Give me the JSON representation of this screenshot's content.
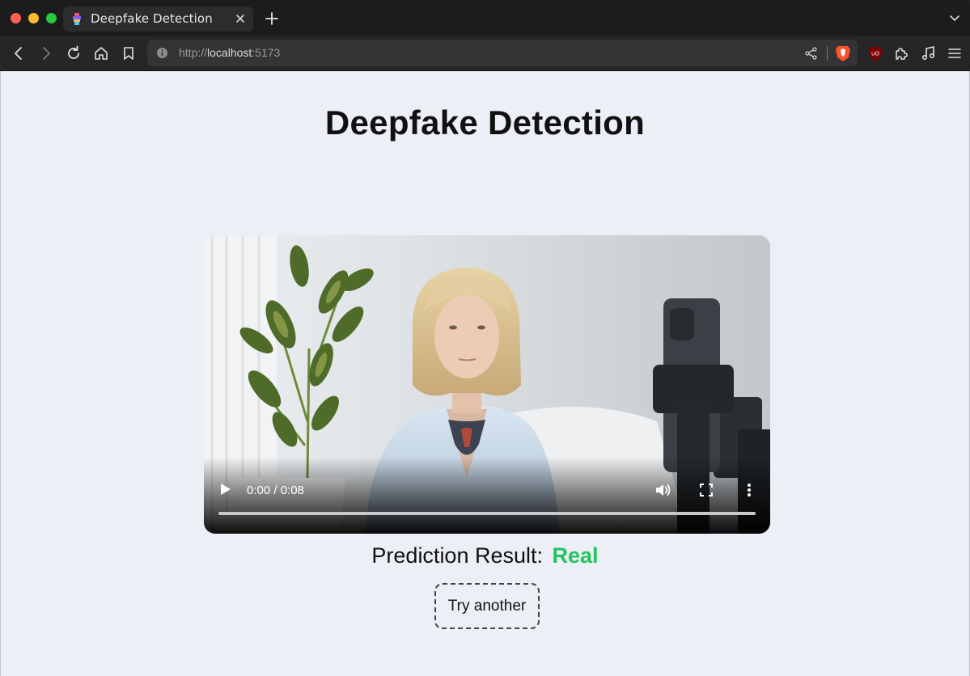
{
  "browser": {
    "tab_title": "Deepfake Detection",
    "url_prefix": "http://",
    "url_host": "localhost",
    "url_port": ":5173"
  },
  "page": {
    "title": "Deepfake Detection",
    "video": {
      "time_display": "0:00 / 0:08",
      "progress": 0
    },
    "result": {
      "label": "Prediction Result:",
      "value": "Real",
      "value_color": "#22c55e"
    },
    "try_button_label": "Try another"
  },
  "icons": [
    "close-icon",
    "plus-icon",
    "chevron-down-icon",
    "back-icon",
    "forward-icon",
    "reload-icon",
    "home-icon",
    "bookmark-icon",
    "info-icon",
    "share-icon",
    "brave-shield-icon",
    "ublock-icon",
    "extensions-icon",
    "media-icon",
    "menu-icon",
    "play-icon",
    "volume-icon",
    "fullscreen-icon",
    "more-options-icon"
  ]
}
